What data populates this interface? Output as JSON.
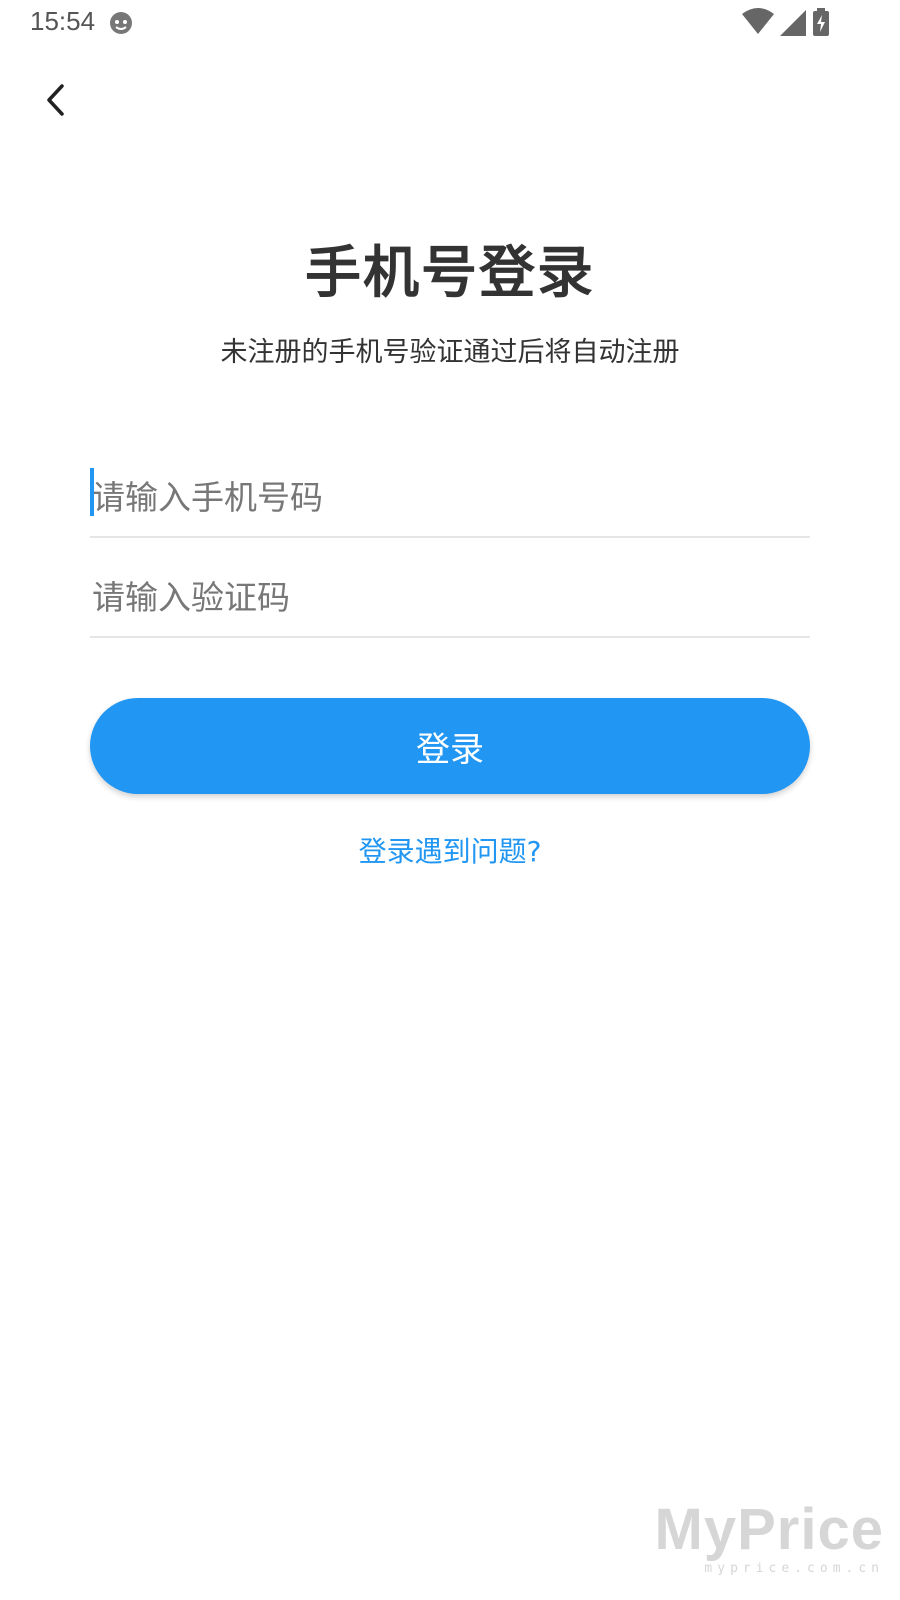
{
  "status_bar": {
    "time": "15:54",
    "icons": [
      "app-notification-icon",
      "wifi-icon",
      "cellular-signal-icon",
      "battery-charging-icon"
    ]
  },
  "header": {
    "back_icon": "chevron-left-icon"
  },
  "login": {
    "title": "手机号登录",
    "subtitle": "未注册的手机号验证通过后将自动注册",
    "phone_placeholder": "请输入手机号码",
    "phone_value": "",
    "code_placeholder": "请输入验证码",
    "code_value": "",
    "submit_label": "登录",
    "help_label": "登录遇到问题?"
  },
  "watermark": {
    "logo": "MyPrice",
    "domain": "myprice.com.cn"
  },
  "colors": {
    "accent": "#2196f3",
    "text": "#333333",
    "placeholder": "#777777",
    "divider": "#e6e6e6"
  }
}
